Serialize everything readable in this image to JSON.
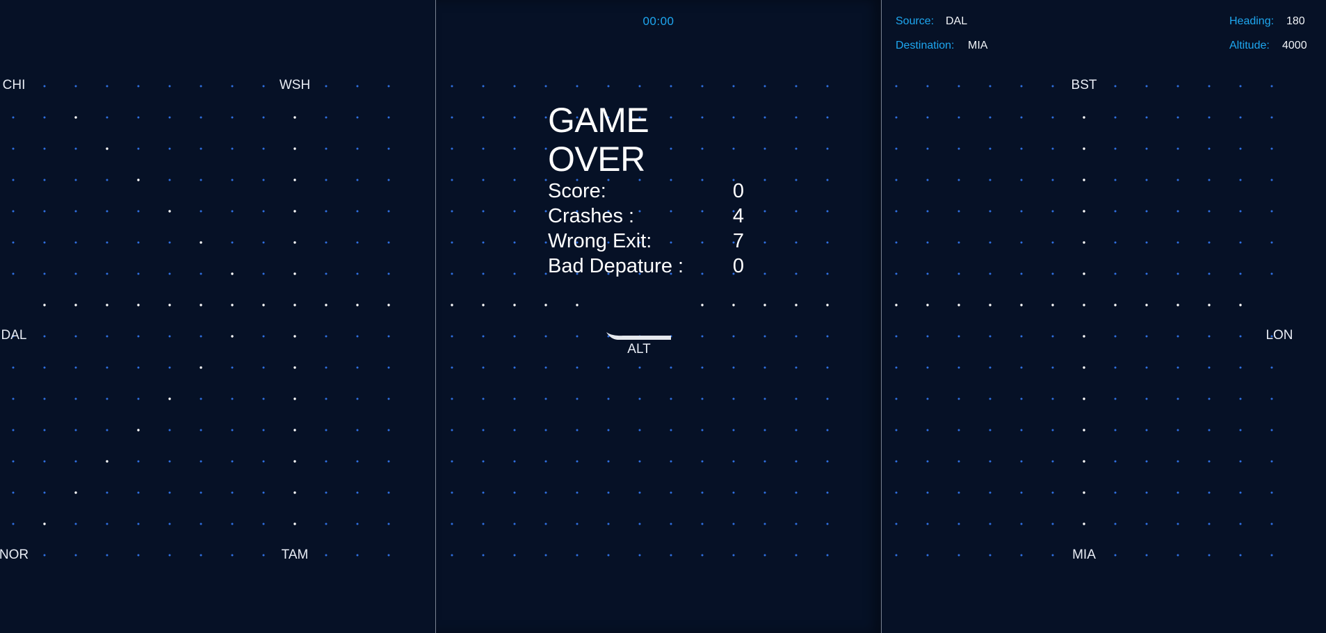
{
  "game": {
    "timer": "00:00",
    "game_over": {
      "title": "GAME OVER",
      "rows": [
        {
          "label": "Score:",
          "value": "0"
        },
        {
          "label": "Crashes :",
          "value": "4"
        },
        {
          "label": "Wrong Exit:",
          "value": "7"
        },
        {
          "label": "Bad Depature :",
          "value": "0"
        }
      ]
    },
    "flight_info": {
      "source_label": "Source:",
      "source_value": "DAL",
      "destination_label": "Destination:",
      "destination_value": "MIA",
      "heading_label": "Heading:",
      "heading_value": "180",
      "altitude_label": "Altitude:",
      "altitude_value": "4000"
    },
    "plane": {
      "label": "ALT"
    },
    "airports": {
      "left": [
        "CHI",
        "WSH",
        "DAL",
        "NOR",
        "TAM"
      ],
      "right": [
        "BST",
        "LON",
        "MIA"
      ]
    },
    "colors": {
      "background": "#061126",
      "grid_dot": "#2f6fe0",
      "route_dot": "#ffffff",
      "accent": "#1ea7f0"
    }
  }
}
